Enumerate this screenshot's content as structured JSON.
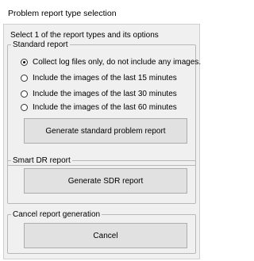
{
  "window": {
    "title": "Problem report type selection"
  },
  "instructions": "Select 1 of the report types and its options",
  "standard_report": {
    "legend": "Standard report",
    "options": [
      {
        "label": "Collect log files only, do not include any images.",
        "checked": true
      },
      {
        "label": "Include the images of the last 15 minutes",
        "checked": false
      },
      {
        "label": "Include the images of the last 30 minutes",
        "checked": false
      },
      {
        "label": "Include the images of the last 60 minutes",
        "checked": false
      }
    ],
    "button_label": "Generate standard problem report"
  },
  "smart_dr_report": {
    "legend": "Smart DR report",
    "button_label": "Generate SDR report"
  },
  "cancel_group": {
    "legend": "Cancel report generation",
    "button_label": "Cancel"
  }
}
